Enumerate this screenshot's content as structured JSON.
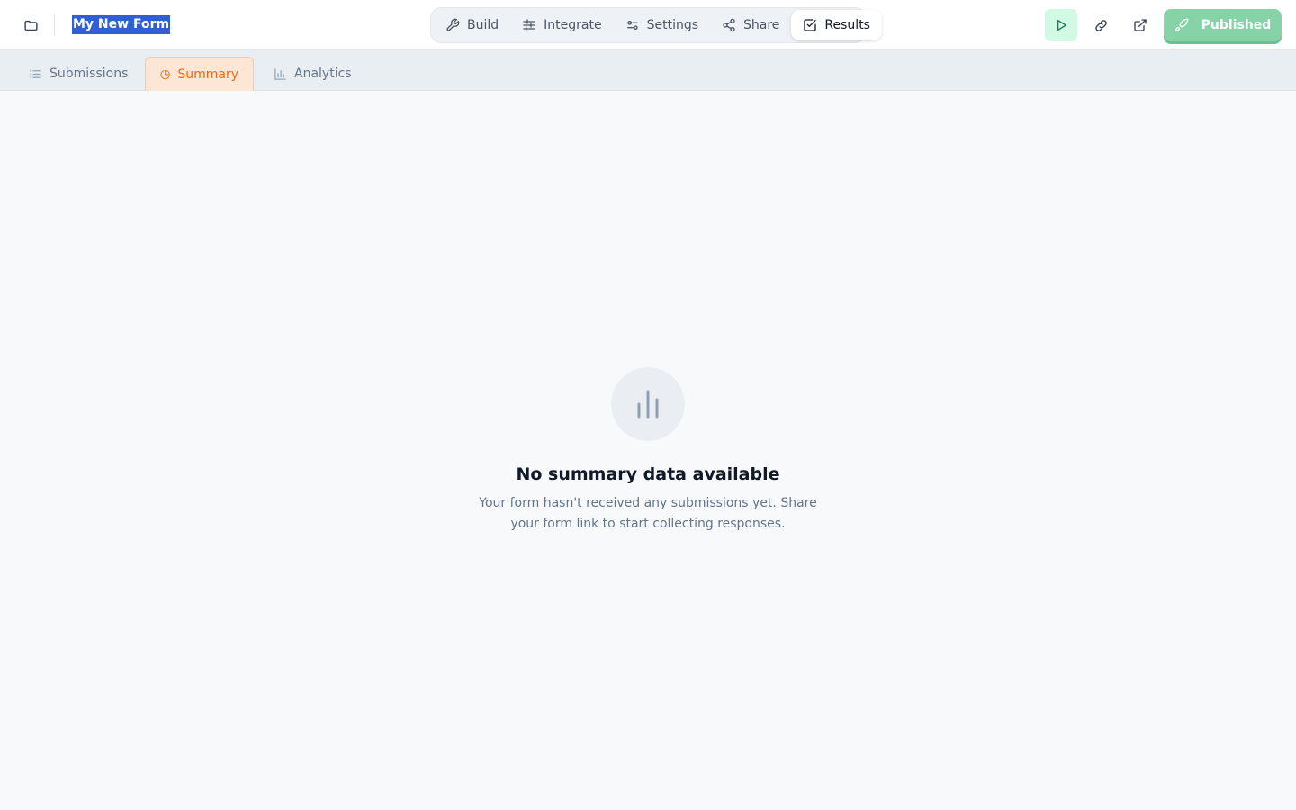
{
  "header": {
    "form_title": "My New Form",
    "folder_icon": "folder-icon",
    "nav": [
      {
        "label": "Build",
        "icon": "wrench-icon"
      },
      {
        "label": "Integrate",
        "icon": "sliders-icon"
      },
      {
        "label": "Settings",
        "icon": "settings-icon"
      },
      {
        "label": "Share",
        "icon": "share-icon"
      },
      {
        "label": "Results",
        "icon": "check-square-icon",
        "active": true
      }
    ],
    "actions": {
      "preview_icon": "play-icon",
      "copy_link_icon": "link-icon",
      "open_icon": "external-link-icon",
      "publish_label": "Published",
      "publish_icon": "rocket-icon"
    }
  },
  "subtabs": [
    {
      "label": "Submissions",
      "icon": "list-icon"
    },
    {
      "label": "Summary",
      "icon": "pie-chart-icon",
      "active": true
    },
    {
      "label": "Analytics",
      "icon": "bar-chart-icon"
    }
  ],
  "empty_state": {
    "icon": "bar-chart-icon",
    "title": "No summary data available",
    "description": "Your form hasn't received any submissions yet. Share your form link to start collecting responses."
  },
  "colors": {
    "accent_orange": "#ea6a14",
    "published_green": "#86d3a8",
    "selection_blue": "#2f5fd0"
  }
}
